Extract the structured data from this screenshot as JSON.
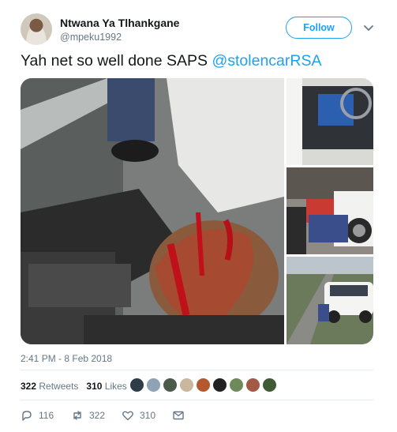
{
  "author": {
    "display_name": "Ntwana Ya Tlhankgane",
    "handle": "@mpeku1992"
  },
  "follow_label": "Follow",
  "tweet": {
    "text": "Yah net so well done SAPS ",
    "mention": "@stolencarRSA"
  },
  "timestamp": "2:41 PM - 8 Feb 2018",
  "stats": {
    "retweets_count": "322",
    "retweets_label": "Retweets",
    "likes_count": "310",
    "likes_label": "Likes"
  },
  "likers": [
    "#2f3d48",
    "#8ea3b4",
    "#4b5a4a",
    "#c9b79e",
    "#b4592d",
    "#222222",
    "#6f8a5a",
    "#a35a44",
    "#3f5a34"
  ],
  "actions": {
    "reply_count": "116",
    "retweet_count": "322",
    "like_count": "310"
  },
  "colors": {
    "accent": "#1da1f2",
    "muted": "#657786",
    "text": "#14171a"
  }
}
